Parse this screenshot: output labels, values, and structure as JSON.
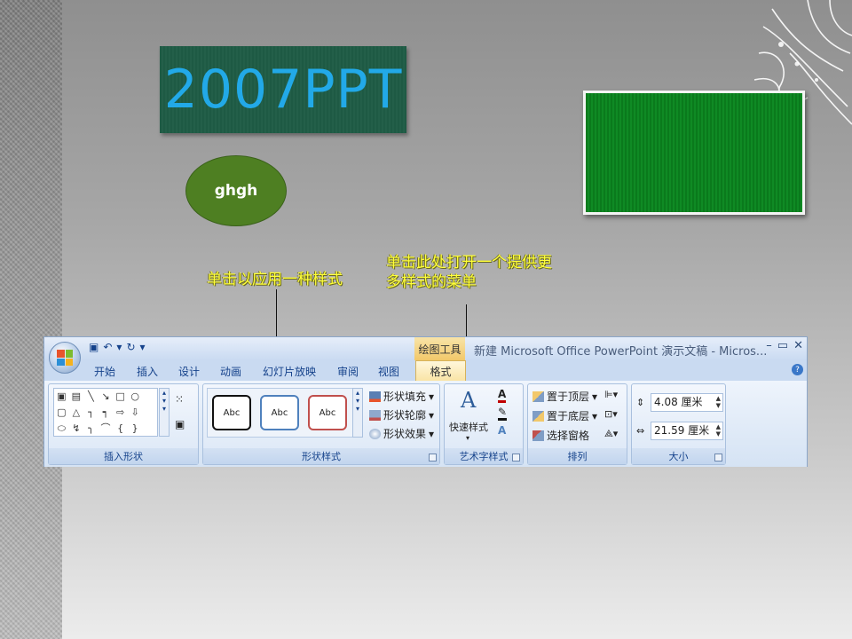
{
  "slide": {
    "title": "2007PPT",
    "oval_text": "ghgh",
    "callout_1": "单击以应用一种样式",
    "callout_2": "单击此处打开一个提供更多样式的菜单"
  },
  "ribbon": {
    "context_tab": "绘图工具",
    "window_title": "新建 Microsoft Office PowerPoint 演示文稿 - Micros...",
    "window_controls": {
      "minimize": "–",
      "restore": "▭",
      "close": "✕"
    },
    "help": "?",
    "qat": {
      "save": "▣",
      "undo": "↶",
      "undo_dd": "▾",
      "redo": "↻",
      "custom": "▾"
    },
    "tabs": [
      "开始",
      "插入",
      "设计",
      "动画",
      "幻灯片放映",
      "审阅",
      "视图"
    ],
    "active_tab": "格式",
    "groups": {
      "insert_shapes": {
        "label": "插入形状",
        "shapes": [
          "▣",
          "▤",
          "╲",
          "↘",
          "□",
          "○",
          "",
          "▢",
          "△",
          "┐",
          "┑",
          "⇨",
          "⇩",
          "",
          "⬭",
          "↯",
          "╮",
          "⌒",
          "{",
          "}",
          ""
        ],
        "edit_shape": "⁙",
        "textbox": "▣"
      },
      "shape_styles": {
        "label": "形状样式",
        "styles": [
          "Abc",
          "Abc",
          "Abc"
        ],
        "fill": "形状填充",
        "outline": "形状轮廓",
        "effects": "形状效果"
      },
      "wordart": {
        "label": "艺术字样式",
        "quick_styles": "快速样式",
        "text_fill": "A",
        "text_effect": "A"
      },
      "arrange": {
        "label": "排列",
        "bring_front": "置于顶层",
        "send_back": "置于底层",
        "selection_pane": "选择窗格"
      },
      "size": {
        "label": "大小",
        "height": "4.08 厘米",
        "width": "21.59 厘米"
      }
    }
  },
  "colors": {
    "title_text": "#22a9e8",
    "title_box": "#1e5a44",
    "oval": "#4e7f22",
    "green_rect": "#0f8a24",
    "callout_text": "#ffff3a"
  }
}
